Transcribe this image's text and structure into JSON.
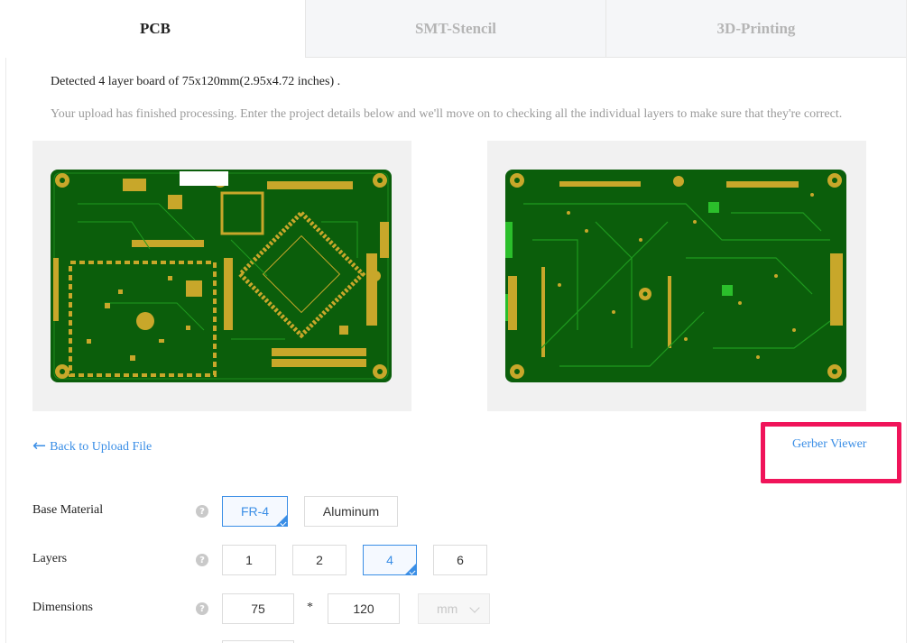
{
  "tabs": [
    {
      "label": "PCB",
      "active": true
    },
    {
      "label": "SMT-Stencil",
      "active": false
    },
    {
      "label": "3D-Printing",
      "active": false
    }
  ],
  "upload": {
    "detected_text": "Detected 4 layer board of 75x120mm(2.95x4.72 inches) .",
    "processed_text": "Your upload has finished processing. Enter the project details below and we'll move on to checking all the individual layers to make sure that they're correct."
  },
  "previews": {
    "top_icon": "pcb-top-layer-image",
    "bottom_icon": "pcb-bottom-layer-image",
    "board_color": "#0b5e0b",
    "pad_color": "#c8a72a"
  },
  "links": {
    "back_arrow": "←",
    "back_label": "Back to Upload File",
    "gerber_viewer_label": "Gerber Viewer"
  },
  "form": {
    "base_material": {
      "label": "Base Material",
      "help": "?",
      "options": [
        "FR-4",
        "Aluminum"
      ],
      "selected": "FR-4"
    },
    "layers": {
      "label": "Layers",
      "help": "?",
      "options": [
        "1",
        "2",
        "4",
        "6"
      ],
      "selected": "4"
    },
    "dimensions": {
      "label": "Dimensions",
      "help": "?",
      "width": "75",
      "separator": "*",
      "height": "120",
      "unit": "mm"
    }
  },
  "colors": {
    "accent": "#3a8ee6",
    "highlight_box": "#f0145a"
  }
}
